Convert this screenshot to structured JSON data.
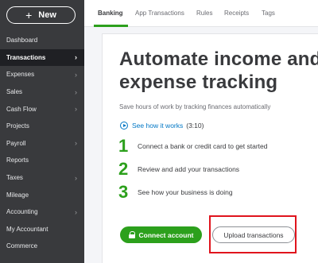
{
  "sidebar": {
    "new_label": "New",
    "items": [
      {
        "label": "Dashboard",
        "chevron": false
      },
      {
        "label": "Transactions",
        "chevron": true,
        "active": true
      },
      {
        "label": "Expenses",
        "chevron": true
      },
      {
        "label": "Sales",
        "chevron": true
      },
      {
        "label": "Cash Flow",
        "chevron": true
      },
      {
        "label": "Projects",
        "chevron": false
      },
      {
        "label": "Payroll",
        "chevron": true
      },
      {
        "label": "Reports",
        "chevron": false
      },
      {
        "label": "Taxes",
        "chevron": true
      },
      {
        "label": "Mileage",
        "chevron": false
      },
      {
        "label": "Accounting",
        "chevron": true
      },
      {
        "label": "My Accountant",
        "chevron": false
      },
      {
        "label": "Commerce",
        "chevron": false
      }
    ]
  },
  "tabs": [
    {
      "label": "Banking",
      "active": true
    },
    {
      "label": "App Transactions"
    },
    {
      "label": "Rules"
    },
    {
      "label": "Receipts"
    },
    {
      "label": "Tags"
    }
  ],
  "main": {
    "headline_line1": "Automate income and",
    "headline_line2": "expense tracking",
    "subtitle": "Save hours of work by tracking finances automatically",
    "how_link": "See how it works",
    "how_duration": "(3:10)",
    "steps": [
      {
        "num": "1",
        "text": "Connect a bank or credit card to get started"
      },
      {
        "num": "2",
        "text": "Review and add your transactions"
      },
      {
        "num": "3",
        "text": "See how your business is doing"
      }
    ],
    "connect_label": "Connect account",
    "upload_label": "Upload transactions"
  },
  "colors": {
    "sidebar_bg": "#393a3d",
    "accent_green": "#2ca01c",
    "link_blue": "#0077c5",
    "highlight_red": "#e0141d"
  },
  "icons": {
    "new_button": "plus-icon",
    "chevrons": "chevron-right-icon",
    "how_link": "play-circle-icon",
    "connect_button": "lock-icon"
  }
}
